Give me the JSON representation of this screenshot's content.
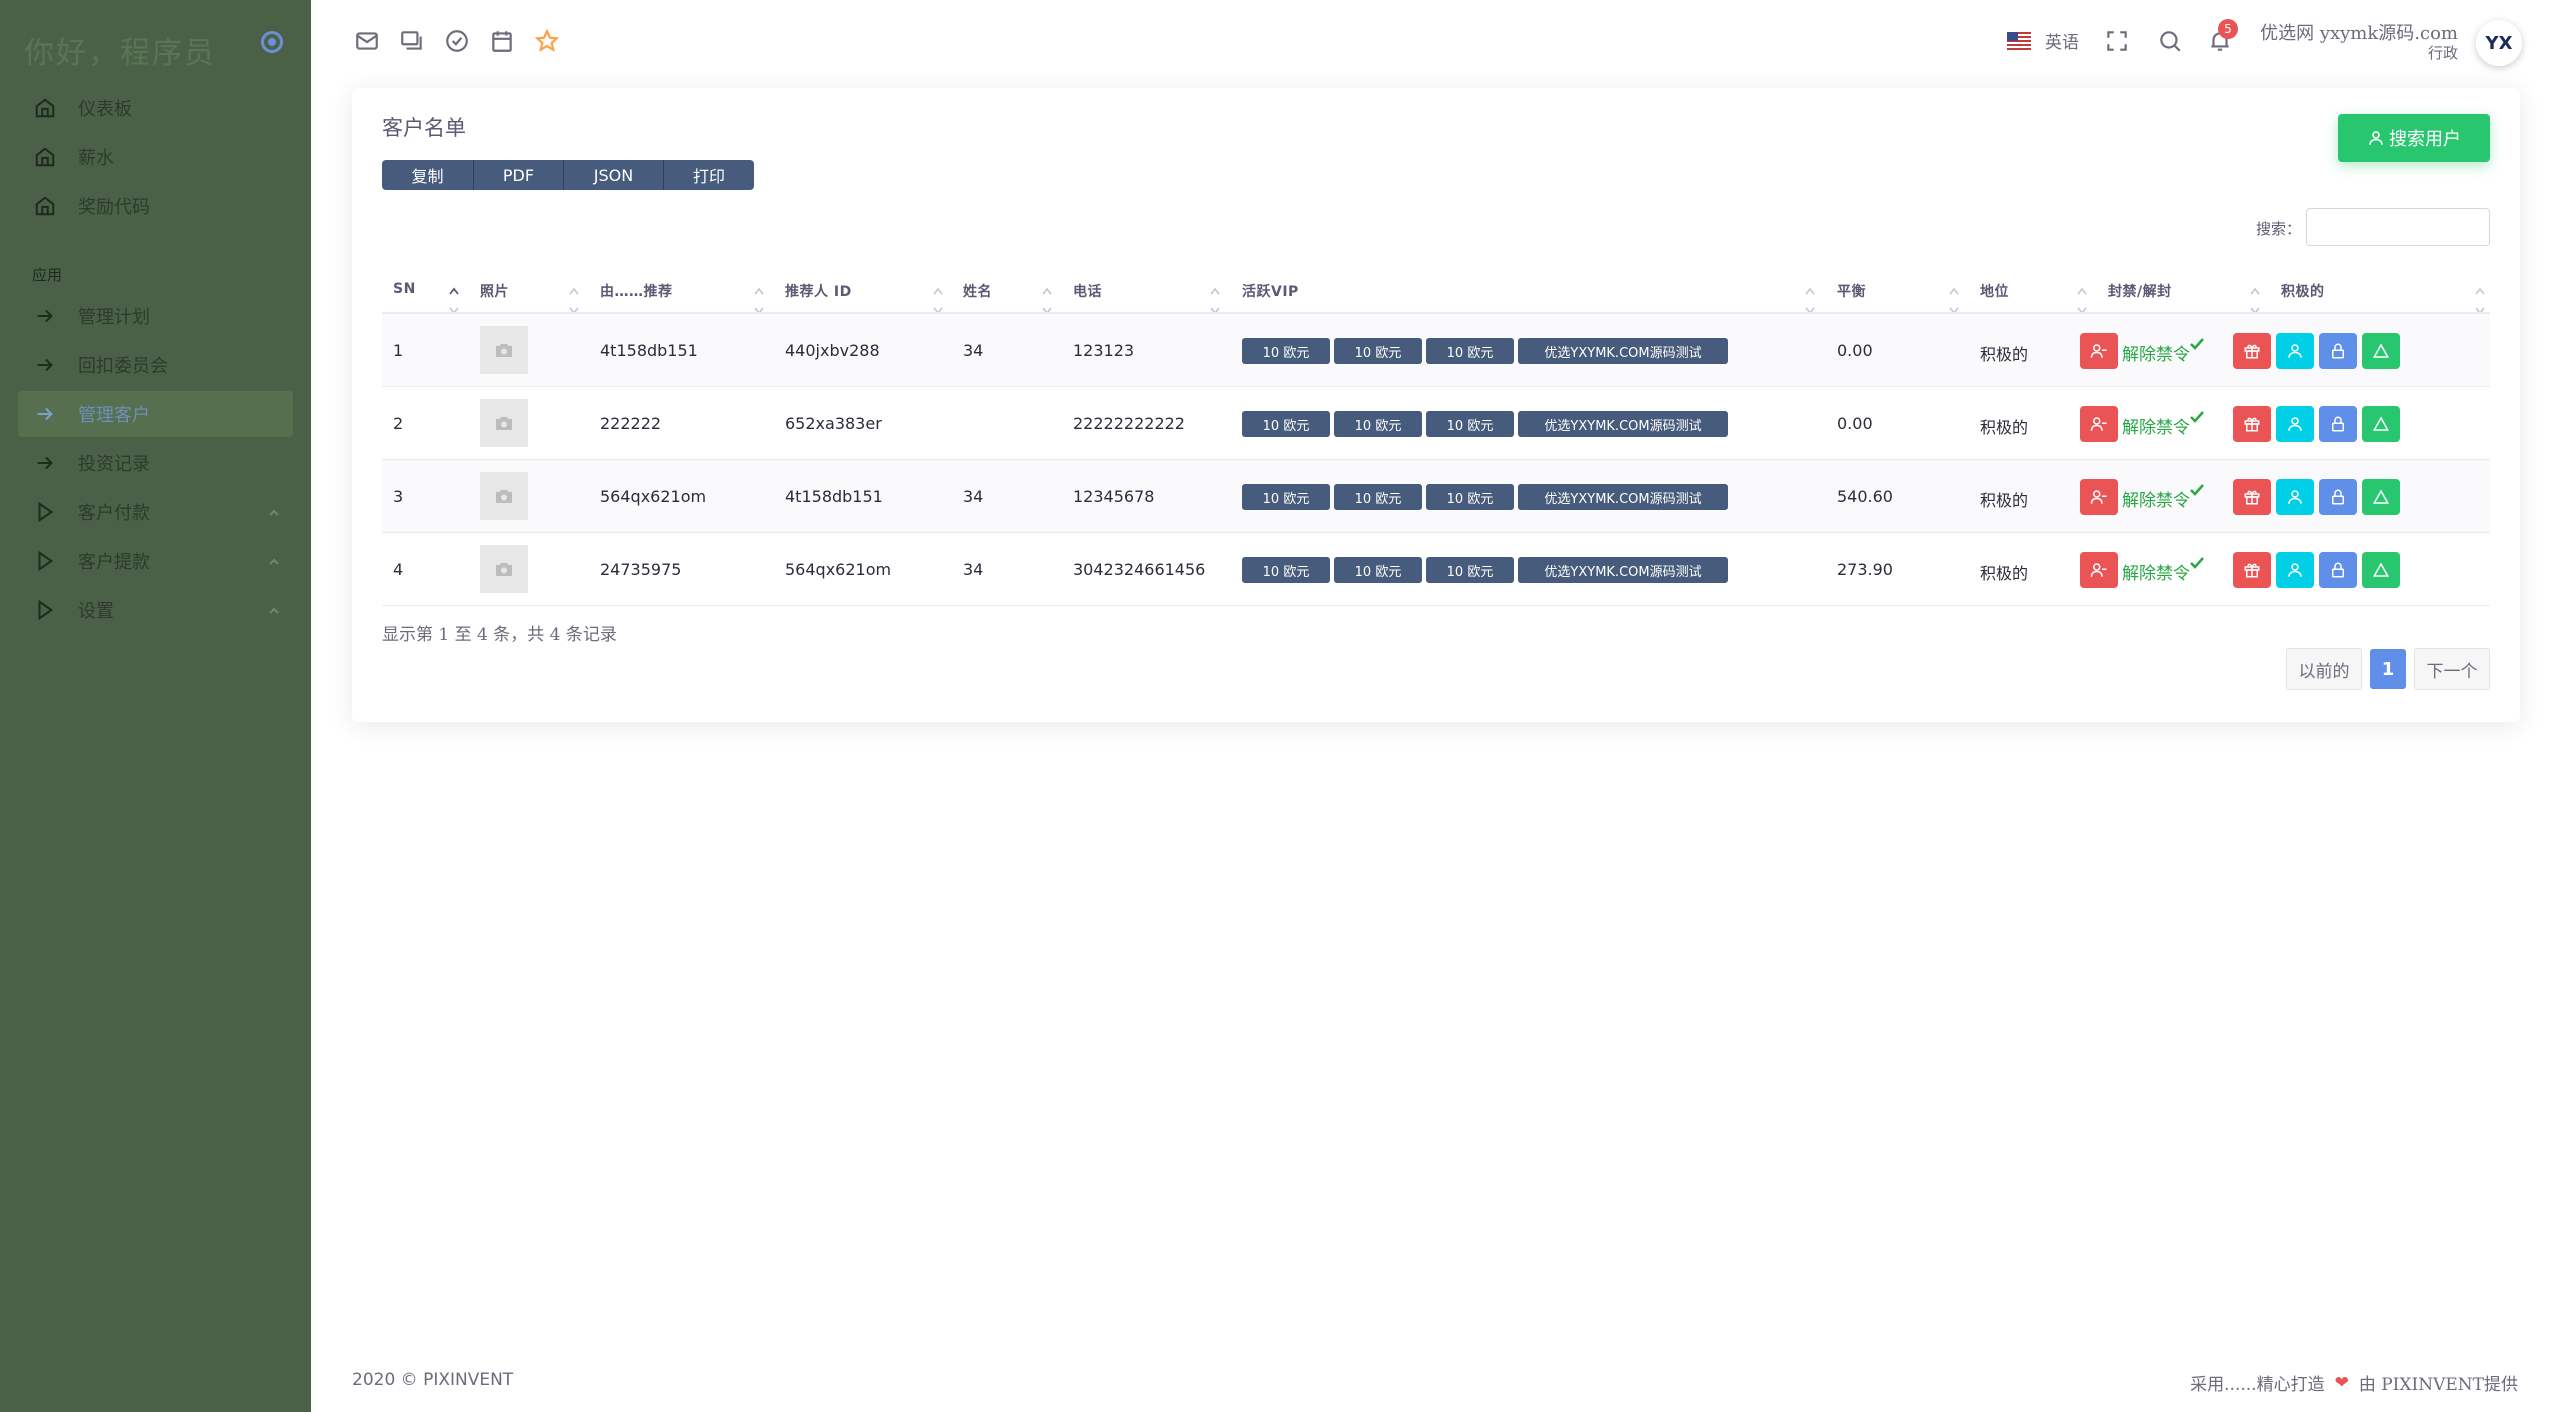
{
  "sidebar": {
    "brand": "你好，程序员",
    "section_label": "应用",
    "items": [
      {
        "label": "仪表板",
        "icon": "home-icon"
      },
      {
        "label": "薪水",
        "icon": "home-icon"
      },
      {
        "label": "奖励代码",
        "icon": "home-icon"
      },
      {
        "label": "管理计划",
        "icon": "arrow-right-icon"
      },
      {
        "label": "回扣委员会",
        "icon": "arrow-right-icon"
      },
      {
        "label": "管理客户",
        "icon": "arrow-right-icon",
        "active": true
      },
      {
        "label": "投资记录",
        "icon": "arrow-right-icon"
      },
      {
        "label": "客户付款",
        "icon": "play-icon"
      },
      {
        "label": "客户提款",
        "icon": "play-icon"
      },
      {
        "label": "设置",
        "icon": "play-icon"
      }
    ]
  },
  "topbar": {
    "language": "英语",
    "notification_count": "5",
    "user_name": "优选网 yxymk源码.com",
    "user_role": "行政",
    "avatar_text": "YX"
  },
  "card": {
    "title": "客户名单",
    "export_buttons": [
      "复制",
      "PDF",
      "JSON",
      "打印"
    ],
    "search_user_label": "搜索用户",
    "search_label": "搜索：",
    "columns": [
      "SN",
      "照片",
      "由……推荐",
      "推荐人 ID",
      "姓名",
      "电话",
      "活跃VIP",
      "平衡",
      "地位",
      "封禁/解封",
      "积极的"
    ],
    "rows": [
      {
        "sn": "1",
        "ref_by": "4t158db151",
        "ref_id": "440jxbv288",
        "name": "34",
        "phone": "123123",
        "vip": [
          "10 欧元",
          "10 欧元",
          "10 欧元",
          "优选YXYMK.COM源码测试"
        ],
        "balance": "0.00",
        "status": "积极的",
        "unban": "解除禁令"
      },
      {
        "sn": "2",
        "ref_by": "222222",
        "ref_id": "652xa383er",
        "name": "",
        "phone": "22222222222",
        "vip": [
          "10 欧元",
          "10 欧元",
          "10 欧元",
          "优选YXYMK.COM源码测试"
        ],
        "balance": "0.00",
        "status": "积极的",
        "unban": "解除禁令"
      },
      {
        "sn": "3",
        "ref_by": "564qx621om",
        "ref_id": "4t158db151",
        "name": "34",
        "phone": "12345678",
        "vip": [
          "10 欧元",
          "10 欧元",
          "10 欧元",
          "优选YXYMK.COM源码测试"
        ],
        "balance": "540.60",
        "status": "积极的",
        "unban": "解除禁令"
      },
      {
        "sn": "4",
        "ref_by": "24735975",
        "ref_id": "564qx621om",
        "name": "34",
        "phone": "3042324661456",
        "vip": [
          "10 欧元",
          "10 欧元",
          "10 欧元",
          "优选YXYMK.COM源码测试"
        ],
        "balance": "273.90",
        "status": "积极的",
        "unban": "解除禁令"
      }
    ],
    "info": "显示第 1 至 4 条，共 4 条记录",
    "pager": {
      "prev": "以前的",
      "current": "1",
      "next": "下一个"
    }
  },
  "colors": {
    "sidebar_bg": "#4a6147",
    "primary_green": "#28c76f",
    "danger": "#ea5455",
    "cyan": "#00cfe8",
    "blue": "#5f8fe8",
    "vip_badge": "#475b7c"
  },
  "footer": {
    "copyright": "2020 © PIXINVENT",
    "made_prefix": "采用......精心打造",
    "made_suffix": "由 PIXINVENT提供"
  }
}
